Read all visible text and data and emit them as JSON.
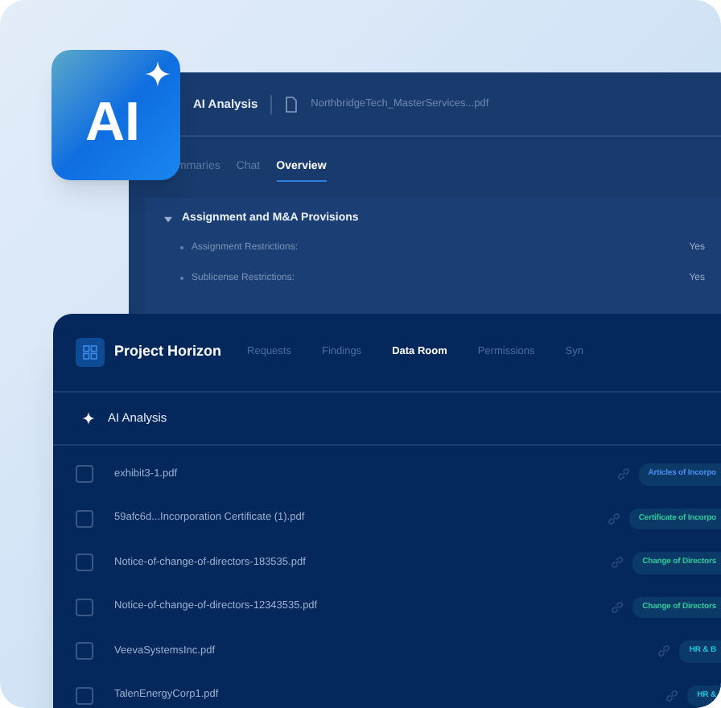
{
  "logo": {
    "text": "AI"
  },
  "back_panel": {
    "title": "AI Analysis",
    "file": "NorthbridgeTech_MasterServices...pdf",
    "tabs": [
      {
        "label": "mmaries",
        "selected": false
      },
      {
        "label": "Chat",
        "selected": false
      },
      {
        "label": "Overview",
        "selected": true
      }
    ],
    "section": {
      "title": "Assignment and M&A Provisions",
      "expanded": true,
      "rows": [
        {
          "label": "Assignment Restrictions:",
          "value": "Yes"
        },
        {
          "label": "Sublicense Restrictions:",
          "value": "Yes"
        }
      ]
    }
  },
  "front_panel": {
    "project": "Project Horizon",
    "nav": [
      {
        "label": "Requests",
        "selected": false
      },
      {
        "label": "Findings",
        "selected": false
      },
      {
        "label": "Data Room",
        "selected": true
      },
      {
        "label": "Permissions",
        "selected": false
      },
      {
        "label": "Syn",
        "selected": false
      }
    ],
    "section_title": "AI Analysis",
    "files": [
      {
        "name": "exhibit3-1.pdf",
        "checked": false,
        "tag": "Articles of Incorpo",
        "color": "#4a8cf0"
      },
      {
        "name": "59afc6d...Incorporation Certificate (1).pdf",
        "checked": false,
        "tag": "Certificate of Incorpo",
        "color": "#2fc79a"
      },
      {
        "name": "Notice-of-change-of-directors-183535.pdf",
        "checked": false,
        "tag": "Change of Directors",
        "color": "#2fc79a"
      },
      {
        "name": "Notice-of-change-of-directors-12343535.pdf",
        "checked": false,
        "tag": "Change of Directors",
        "color": "#2fc79a"
      },
      {
        "name": "VeevaSystemsInc.pdf",
        "checked": false,
        "tag": "HR & B",
        "color": "#22c3de"
      },
      {
        "name": "TalenEnergyCorp1.pdf",
        "checked": false,
        "tag": "HR &",
        "color": "#22c3de"
      }
    ]
  }
}
